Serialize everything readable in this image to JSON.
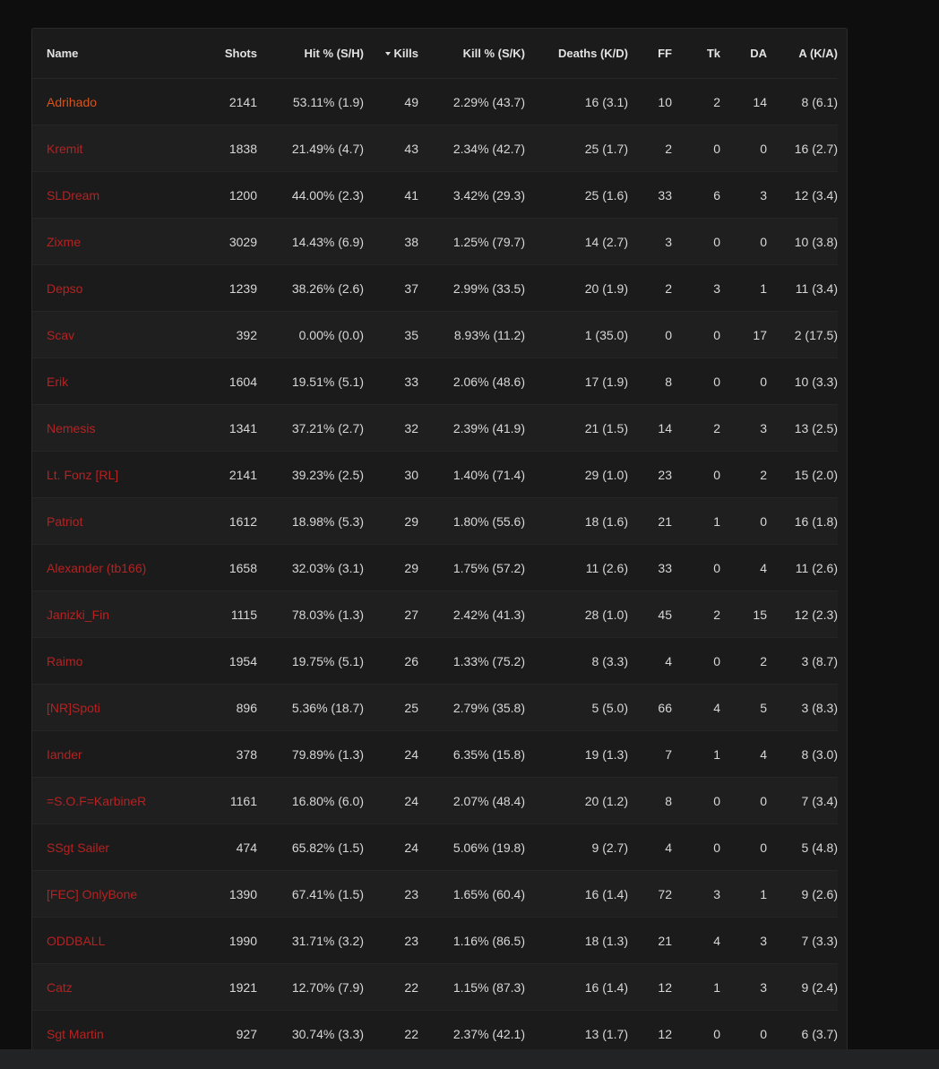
{
  "headers": {
    "name": "Name",
    "shots": "Shots",
    "hit": "Hit % (S/H)",
    "kills": "Kills",
    "kill": "Kill % (S/K)",
    "deaths": "Deaths (K/D)",
    "ff": "FF",
    "tk": "Tk",
    "da": "DA",
    "a": "A (K/A)"
  },
  "sort": {
    "column": "kills",
    "direction": "desc",
    "icon": "caret-down-icon"
  },
  "colors": {
    "name_link": "#b52222",
    "name_highlight": "#d8541c",
    "text": "#d8d8d8"
  },
  "rows": [
    {
      "name": "Adrihado",
      "shots": "2141",
      "hit": "53.11% (1.9)",
      "kills": "49",
      "kill": "2.29% (43.7)",
      "deaths": "16 (3.1)",
      "ff": "10",
      "tk": "2",
      "da": "14",
      "a": "8 (6.1)"
    },
    {
      "name": "Kremit",
      "shots": "1838",
      "hit": "21.49% (4.7)",
      "kills": "43",
      "kill": "2.34% (42.7)",
      "deaths": "25 (1.7)",
      "ff": "2",
      "tk": "0",
      "da": "0",
      "a": "16 (2.7)"
    },
    {
      "name": "SLDream",
      "shots": "1200",
      "hit": "44.00% (2.3)",
      "kills": "41",
      "kill": "3.42% (29.3)",
      "deaths": "25 (1.6)",
      "ff": "33",
      "tk": "6",
      "da": "3",
      "a": "12 (3.4)"
    },
    {
      "name": "Zixme",
      "shots": "3029",
      "hit": "14.43% (6.9)",
      "kills": "38",
      "kill": "1.25% (79.7)",
      "deaths": "14 (2.7)",
      "ff": "3",
      "tk": "0",
      "da": "0",
      "a": "10 (3.8)"
    },
    {
      "name": "Depso",
      "shots": "1239",
      "hit": "38.26% (2.6)",
      "kills": "37",
      "kill": "2.99% (33.5)",
      "deaths": "20 (1.9)",
      "ff": "2",
      "tk": "3",
      "da": "1",
      "a": "11 (3.4)"
    },
    {
      "name": "Scav",
      "shots": "392",
      "hit": "0.00% (0.0)",
      "kills": "35",
      "kill": "8.93% (11.2)",
      "deaths": "1 (35.0)",
      "ff": "0",
      "tk": "0",
      "da": "17",
      "a": "2 (17.5)"
    },
    {
      "name": "Erik",
      "shots": "1604",
      "hit": "19.51% (5.1)",
      "kills": "33",
      "kill": "2.06% (48.6)",
      "deaths": "17 (1.9)",
      "ff": "8",
      "tk": "0",
      "da": "0",
      "a": "10 (3.3)"
    },
    {
      "name": "Nemesis",
      "shots": "1341",
      "hit": "37.21% (2.7)",
      "kills": "32",
      "kill": "2.39% (41.9)",
      "deaths": "21 (1.5)",
      "ff": "14",
      "tk": "2",
      "da": "3",
      "a": "13 (2.5)"
    },
    {
      "name": "Lt. Fonz [RL]",
      "shots": "2141",
      "hit": "39.23% (2.5)",
      "kills": "30",
      "kill": "1.40% (71.4)",
      "deaths": "29 (1.0)",
      "ff": "23",
      "tk": "0",
      "da": "2",
      "a": "15 (2.0)"
    },
    {
      "name": "Patriot",
      "shots": "1612",
      "hit": "18.98% (5.3)",
      "kills": "29",
      "kill": "1.80% (55.6)",
      "deaths": "18 (1.6)",
      "ff": "21",
      "tk": "1",
      "da": "0",
      "a": "16 (1.8)"
    },
    {
      "name": "Alexander (tb166)",
      "shots": "1658",
      "hit": "32.03% (3.1)",
      "kills": "29",
      "kill": "1.75% (57.2)",
      "deaths": "11 (2.6)",
      "ff": "33",
      "tk": "0",
      "da": "4",
      "a": "11 (2.6)"
    },
    {
      "name": "Janizki_Fin",
      "shots": "1115",
      "hit": "78.03% (1.3)",
      "kills": "27",
      "kill": "2.42% (41.3)",
      "deaths": "28 (1.0)",
      "ff": "45",
      "tk": "2",
      "da": "15",
      "a": "12 (2.3)"
    },
    {
      "name": "Raimo",
      "shots": "1954",
      "hit": "19.75% (5.1)",
      "kills": "26",
      "kill": "1.33% (75.2)",
      "deaths": "8 (3.3)",
      "ff": "4",
      "tk": "0",
      "da": "2",
      "a": "3 (8.7)"
    },
    {
      "name": "[NR]Spoti",
      "shots": "896",
      "hit": "5.36% (18.7)",
      "kills": "25",
      "kill": "2.79% (35.8)",
      "deaths": "5 (5.0)",
      "ff": "66",
      "tk": "4",
      "da": "5",
      "a": "3 (8.3)"
    },
    {
      "name": "Iander",
      "shots": "378",
      "hit": "79.89% (1.3)",
      "kills": "24",
      "kill": "6.35% (15.8)",
      "deaths": "19 (1.3)",
      "ff": "7",
      "tk": "1",
      "da": "4",
      "a": "8 (3.0)"
    },
    {
      "name": "=S.O.F=KarbineR",
      "shots": "1161",
      "hit": "16.80% (6.0)",
      "kills": "24",
      "kill": "2.07% (48.4)",
      "deaths": "20 (1.2)",
      "ff": "8",
      "tk": "0",
      "da": "0",
      "a": "7 (3.4)"
    },
    {
      "name": "SSgt Sailer",
      "shots": "474",
      "hit": "65.82% (1.5)",
      "kills": "24",
      "kill": "5.06% (19.8)",
      "deaths": "9 (2.7)",
      "ff": "4",
      "tk": "0",
      "da": "0",
      "a": "5 (4.8)"
    },
    {
      "name": "[FEC] OnlyBone",
      "shots": "1390",
      "hit": "67.41% (1.5)",
      "kills": "23",
      "kill": "1.65% (60.4)",
      "deaths": "16 (1.4)",
      "ff": "72",
      "tk": "3",
      "da": "1",
      "a": "9 (2.6)"
    },
    {
      "name": "ODDBALL",
      "shots": "1990",
      "hit": "31.71% (3.2)",
      "kills": "23",
      "kill": "1.16% (86.5)",
      "deaths": "18 (1.3)",
      "ff": "21",
      "tk": "4",
      "da": "3",
      "a": "7 (3.3)"
    },
    {
      "name": "Catz",
      "shots": "1921",
      "hit": "12.70% (7.9)",
      "kills": "22",
      "kill": "1.15% (87.3)",
      "deaths": "16 (1.4)",
      "ff": "12",
      "tk": "1",
      "da": "3",
      "a": "9 (2.4)"
    },
    {
      "name": "Sgt Martin",
      "shots": "927",
      "hit": "30.74% (3.3)",
      "kills": "22",
      "kill": "2.37% (42.1)",
      "deaths": "13 (1.7)",
      "ff": "12",
      "tk": "0",
      "da": "0",
      "a": "6 (3.7)"
    }
  ]
}
